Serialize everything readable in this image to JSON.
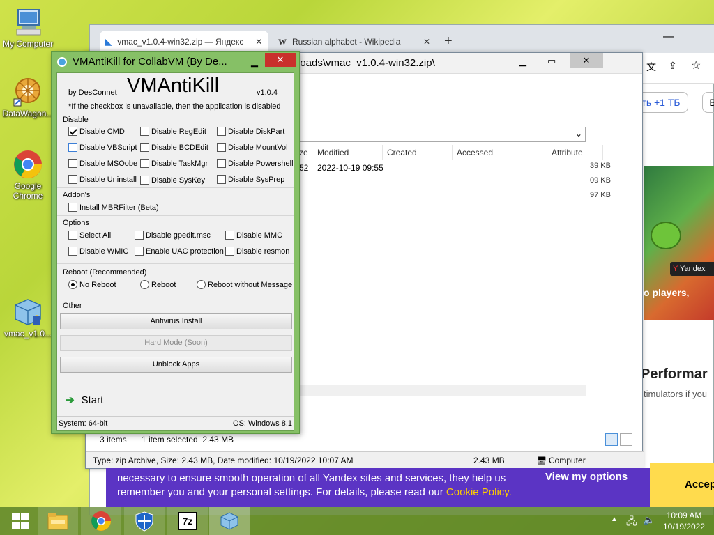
{
  "desktop": {
    "icons": [
      {
        "label": "My Computer"
      },
      {
        "label": "DataWagon..."
      },
      {
        "label": "Google Chrome"
      },
      {
        "label": "vmac_v1.0..."
      }
    ]
  },
  "browser": {
    "tabs": [
      {
        "label": "vmac_v1.0.4-win32.zip — Яндекс"
      },
      {
        "label": "Russian alphabet - Wikipedia"
      }
    ],
    "promo_button": "ть +1 ТБ",
    "promo_button2": "В",
    "file_sizes": [
      "39 KB",
      "09 KB",
      "97 KB"
    ],
    "game_badge": "Yandex",
    "headline": "o players,",
    "section_title": "Performar",
    "section_sub": "timulators if you"
  },
  "explorer": {
    "path": "loads\\vmac_v1.0.4-win32.zip\\",
    "columns": [
      "ze",
      "Modified",
      "Created",
      "Accessed",
      "Attribute"
    ],
    "row": {
      "size": "52",
      "modified": "2022-10-19 09:55"
    },
    "items_count": "3 items",
    "selection": "1 item selected  2.43 MB",
    "status_text": "Type: zip Archive, Size: 2.43 MB, Date modified: 10/19/2022 10:07 AM",
    "status_size": "2.43 MB",
    "status_location": "Computer"
  },
  "vmak": {
    "title": "VMAntiKill for CollabVM (By De...",
    "heading": "VMAntiKill",
    "author": "by DesConnet",
    "version": "v1.0.4",
    "note": "*If the checkbox is unavailable, then the application is disabled",
    "disable_label": "Disable",
    "disable_items": [
      {
        "label": "Disable CMD",
        "checked": true
      },
      {
        "label": "Disable RegEdit",
        "checked": false
      },
      {
        "label": "Disable DiskPart",
        "checked": false
      },
      {
        "label": "Disable VBScript",
        "checked": false
      },
      {
        "label": "Disable BCDEdit",
        "checked": false
      },
      {
        "label": "Disable MountVol",
        "checked": false
      },
      {
        "label": "Disable MSOobe",
        "checked": false
      },
      {
        "label": "Disable TaskMgr",
        "checked": false
      },
      {
        "label": "Disable Powershell",
        "checked": false
      },
      {
        "label": "Disable Uninstall",
        "checked": false
      },
      {
        "label": "Disable SysKey",
        "checked": false
      },
      {
        "label": "Disable SysPrep",
        "checked": false
      }
    ],
    "addons_label": "Addon's",
    "addon_item": "Install MBRFilter (Beta)",
    "options_label": "Options",
    "option_items": [
      {
        "label": "Select All"
      },
      {
        "label": "Disable gpedit.msc"
      },
      {
        "label": "Disable MMC"
      },
      {
        "label": "Disable WMIC"
      },
      {
        "label": "Enable UAC protection"
      },
      {
        "label": "Disable resmon"
      }
    ],
    "reboot_label": "Reboot (Recommended)",
    "reboot_options": [
      {
        "label": "No Reboot",
        "selected": true
      },
      {
        "label": "Reboot",
        "selected": false
      },
      {
        "label": "Reboot without Message",
        "selected": false
      }
    ],
    "other_label": "Other",
    "btn_antivirus": "Antivirus Install",
    "btn_hardmode": "Hard Mode (Soon)",
    "btn_unblock": "Unblock Apps",
    "start_label": "Start",
    "system_info": "System: 64-bit",
    "os_info": "OS: Windows 8.1"
  },
  "cookie": {
    "text1": "necessary to ensure smooth operation of all Yandex sites and services, they help us",
    "text2": "remember you and your personal settings. For details, please read our ",
    "link": "Cookie Policy.",
    "options": "View my options",
    "accept": "Accep"
  },
  "taskbar": {
    "time": "10:09 AM",
    "date": "10/19/2022",
    "app7z": "7z"
  }
}
